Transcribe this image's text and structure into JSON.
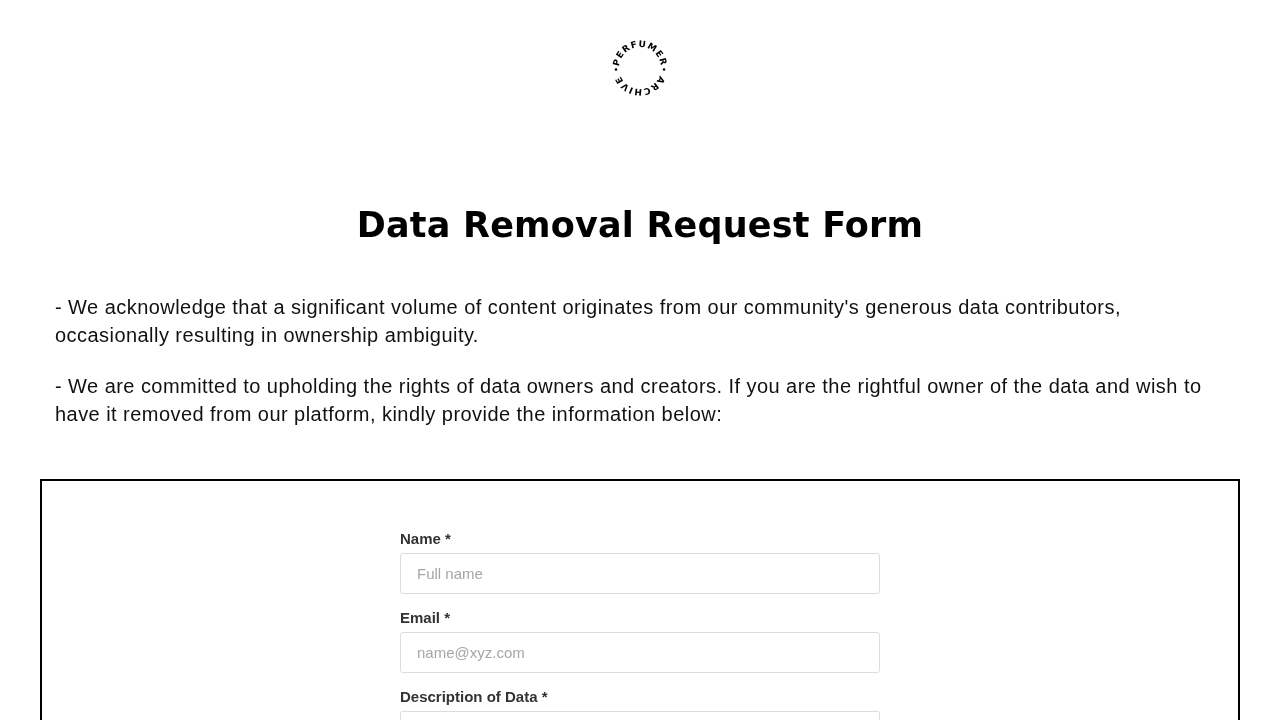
{
  "logo": {
    "top_text": "PERFUMER",
    "bottom_text": "ARCHIVE"
  },
  "title": "Data Removal Request Form",
  "intro": [
    "- We acknowledge that a significant volume of content originates from our community's generous data contributors, occasionally resulting in ownership ambiguity.",
    "- We are committed to upholding the rights of data owners and creators. If you are the rightful owner of the data and wish to have it removed from our platform, kindly provide the information below:"
  ],
  "form": {
    "fields": [
      {
        "kind": "input",
        "label": "Name *",
        "placeholder": "Full name"
      },
      {
        "kind": "input",
        "label": "Email *",
        "placeholder": "name@xyz.com"
      },
      {
        "kind": "textarea",
        "label": "Description of Data *"
      }
    ]
  }
}
